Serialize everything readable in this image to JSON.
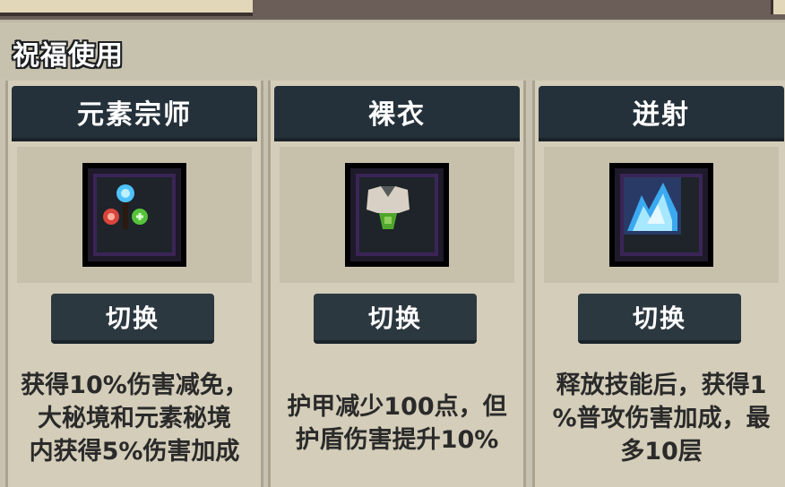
{
  "section": {
    "title": "祝福使用"
  },
  "cards": [
    {
      "name": "元素宗师",
      "button": "切换",
      "desc_lines": [
        "获得10%伤害减免，",
        "大秘境和元素秘境",
        "内获得5%伤害加成"
      ],
      "icon": "elemental-orbs-icon"
    },
    {
      "name": "裸衣",
      "button": "切换",
      "desc_lines": [
        "护甲减少100点，但",
        "护盾伤害提升10%"
      ],
      "icon": "bare-armor-icon"
    },
    {
      "name": "迸射",
      "button": "切换",
      "desc_lines": [
        "释放技能后，获得1",
        "%普攻伤害加成，最",
        "多10层"
      ],
      "icon": "ice-burst-icon"
    }
  ],
  "colors": {
    "card_header": "#25313a",
    "button": "#2c3840",
    "frame_purple": "#5a3b7c",
    "background": "#c8c3b0"
  }
}
